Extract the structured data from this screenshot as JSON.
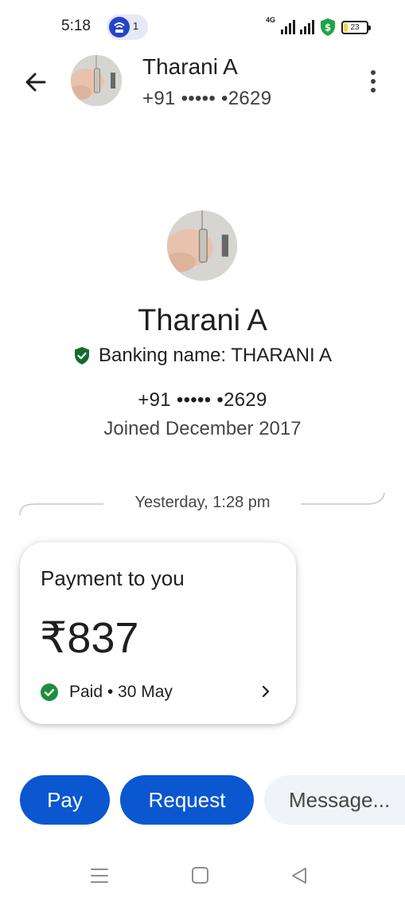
{
  "status_bar": {
    "time": "5:18",
    "hotspot_count": "1",
    "network": "4G",
    "battery": "23"
  },
  "header": {
    "name": "Tharani A",
    "phone": "+91 ••••• •2629"
  },
  "profile": {
    "name": "Tharani A",
    "banking_name": "Banking name: THARANI A",
    "phone": "+91 ••••• •2629",
    "joined": "Joined December 2017"
  },
  "divider": {
    "text": "Yesterday, 1:28 pm"
  },
  "payment_card": {
    "title": "Payment to you",
    "amount": "₹837",
    "status": "Paid • 30 May"
  },
  "actions": {
    "pay": "Pay",
    "request": "Request",
    "message_placeholder": "Message..."
  },
  "colors": {
    "primary": "#0b57d0",
    "verified_green": "#146c2e",
    "paid_green": "#1e8e3e",
    "security_green": "#1ea446"
  },
  "icons": {
    "back": "arrow-left",
    "more": "three-dots-vertical",
    "verified": "shield-check",
    "paid": "check-circle",
    "chevron": "chevron-right",
    "nav_recent": "menu-lines",
    "nav_home": "square",
    "nav_back": "triangle-left"
  }
}
